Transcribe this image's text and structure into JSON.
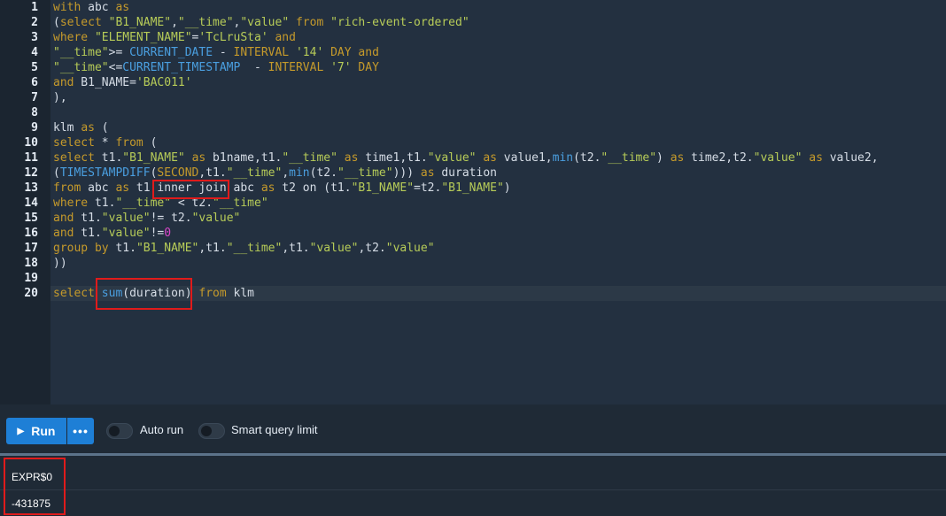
{
  "editor": {
    "lines": [
      {
        "num": "1",
        "tokens": [
          [
            "kw",
            "with"
          ],
          [
            "id",
            " abc "
          ],
          [
            "kw",
            "as"
          ]
        ]
      },
      {
        "num": "2",
        "tokens": [
          [
            "id",
            "("
          ],
          [
            "kw",
            "select"
          ],
          [
            "id",
            " "
          ],
          [
            "str",
            "\"B1_NAME\""
          ],
          [
            "id",
            ","
          ],
          [
            "str",
            "\"__time\""
          ],
          [
            "id",
            ","
          ],
          [
            "str",
            "\"value\""
          ],
          [
            "id",
            " "
          ],
          [
            "kw",
            "from"
          ],
          [
            "id",
            " "
          ],
          [
            "str",
            "\"rich-event-ordered\""
          ]
        ]
      },
      {
        "num": "3",
        "tokens": [
          [
            "kw",
            "where"
          ],
          [
            "id",
            " "
          ],
          [
            "str",
            "\"ELEMENT_NAME\""
          ],
          [
            "id",
            "="
          ],
          [
            "str",
            "'TcLruSta'"
          ],
          [
            "id",
            " "
          ],
          [
            "kw",
            "and"
          ]
        ]
      },
      {
        "num": "4",
        "tokens": [
          [
            "str",
            "\"__time\""
          ],
          [
            "id",
            ">= "
          ],
          [
            "fn",
            "CURRENT_DATE"
          ],
          [
            "id",
            " - "
          ],
          [
            "kw",
            "INTERVAL"
          ],
          [
            "id",
            " "
          ],
          [
            "str",
            "'14'"
          ],
          [
            "id",
            " "
          ],
          [
            "kw",
            "DAY"
          ],
          [
            "id",
            " "
          ],
          [
            "kw",
            "and"
          ]
        ]
      },
      {
        "num": "5",
        "tokens": [
          [
            "str",
            "\"__time\""
          ],
          [
            "id",
            "<="
          ],
          [
            "fn",
            "CURRENT_TIMESTAMP"
          ],
          [
            "id",
            "  - "
          ],
          [
            "kw",
            "INTERVAL"
          ],
          [
            "id",
            " "
          ],
          [
            "str",
            "'7'"
          ],
          [
            "id",
            " "
          ],
          [
            "kw",
            "DAY"
          ]
        ]
      },
      {
        "num": "6",
        "tokens": [
          [
            "kw",
            "and"
          ],
          [
            "id",
            " B1_NAME="
          ],
          [
            "str",
            "'BAC011'"
          ]
        ]
      },
      {
        "num": "7",
        "tokens": [
          [
            "id",
            "),"
          ]
        ]
      },
      {
        "num": "8",
        "tokens": []
      },
      {
        "num": "9",
        "tokens": [
          [
            "id",
            "klm "
          ],
          [
            "kw",
            "as"
          ],
          [
            "id",
            " ("
          ]
        ]
      },
      {
        "num": "10",
        "tokens": [
          [
            "kw",
            "select"
          ],
          [
            "id",
            " * "
          ],
          [
            "kw",
            "from"
          ],
          [
            "id",
            " ("
          ]
        ]
      },
      {
        "num": "11",
        "tokens": [
          [
            "kw",
            "select"
          ],
          [
            "id",
            " t1."
          ],
          [
            "str",
            "\"B1_NAME\""
          ],
          [
            "id",
            " "
          ],
          [
            "kw",
            "as"
          ],
          [
            "id",
            " b1name,t1."
          ],
          [
            "str",
            "\"__time\""
          ],
          [
            "id",
            " "
          ],
          [
            "kw",
            "as"
          ],
          [
            "id",
            " time1,t1."
          ],
          [
            "str",
            "\"value\""
          ],
          [
            "id",
            " "
          ],
          [
            "kw",
            "as"
          ],
          [
            "id",
            " value1,"
          ],
          [
            "fn",
            "min"
          ],
          [
            "id",
            "(t2."
          ],
          [
            "str",
            "\"__time\""
          ],
          [
            "id",
            ") "
          ],
          [
            "kw",
            "as"
          ],
          [
            "id",
            " time2,t2."
          ],
          [
            "str",
            "\"value\""
          ],
          [
            "id",
            " "
          ],
          [
            "kw",
            "as"
          ],
          [
            "id",
            " value2,"
          ]
        ]
      },
      {
        "num": "12",
        "tokens": [
          [
            "id",
            "("
          ],
          [
            "fn",
            "TIMESTAMPDIFF"
          ],
          [
            "id",
            "("
          ],
          [
            "kw",
            "SECOND"
          ],
          [
            "id",
            ",t1."
          ],
          [
            "str",
            "\"__time\""
          ],
          [
            "id",
            ","
          ],
          [
            "fn",
            "min"
          ],
          [
            "id",
            "(t2."
          ],
          [
            "str",
            "\"__time\""
          ],
          [
            "id",
            "))) "
          ],
          [
            "kw",
            "as"
          ],
          [
            "id",
            " duration"
          ]
        ]
      },
      {
        "num": "13",
        "tokens": [
          [
            "kw",
            "from"
          ],
          [
            "id",
            " abc "
          ],
          [
            "kw",
            "as"
          ],
          [
            "id",
            " t1 inner join abc "
          ],
          [
            "kw",
            "as"
          ],
          [
            "id",
            " t2 on (t1."
          ],
          [
            "str",
            "\"B1_NAME\""
          ],
          [
            "id",
            "=t2."
          ],
          [
            "str",
            "\"B1_NAME\""
          ],
          [
            "id",
            ")"
          ]
        ]
      },
      {
        "num": "14",
        "tokens": [
          [
            "kw",
            "where"
          ],
          [
            "id",
            " t1."
          ],
          [
            "str",
            "\"__time\""
          ],
          [
            "id",
            " < t2."
          ],
          [
            "str",
            "\"__time\""
          ]
        ]
      },
      {
        "num": "15",
        "tokens": [
          [
            "kw",
            "and"
          ],
          [
            "id",
            " t1."
          ],
          [
            "str",
            "\"value\""
          ],
          [
            "id",
            "!= t2."
          ],
          [
            "str",
            "\"value\""
          ]
        ]
      },
      {
        "num": "16",
        "tokens": [
          [
            "kw",
            "and"
          ],
          [
            "id",
            " t1."
          ],
          [
            "str",
            "\"value\""
          ],
          [
            "id",
            "!="
          ],
          [
            "num",
            "0"
          ]
        ]
      },
      {
        "num": "17",
        "tokens": [
          [
            "kw",
            "group by"
          ],
          [
            "id",
            " t1."
          ],
          [
            "str",
            "\"B1_NAME\""
          ],
          [
            "id",
            ",t1."
          ],
          [
            "str",
            "\"__time\""
          ],
          [
            "id",
            ",t1."
          ],
          [
            "str",
            "\"value\""
          ],
          [
            "id",
            ",t2."
          ],
          [
            "str",
            "\"value\""
          ]
        ]
      },
      {
        "num": "18",
        "tokens": [
          [
            "id",
            "))"
          ]
        ]
      },
      {
        "num": "19",
        "tokens": []
      },
      {
        "num": "20",
        "tokens": [
          [
            "kw",
            "select"
          ],
          [
            "id",
            " "
          ],
          [
            "fn",
            "sum"
          ],
          [
            "id",
            "(duration) "
          ],
          [
            "kw",
            "from"
          ],
          [
            "id",
            " klm"
          ]
        ]
      }
    ]
  },
  "toolbar": {
    "run_label": "Run",
    "more_label": "•••",
    "auto_run_label": "Auto run",
    "smart_limit_label": "Smart query limit"
  },
  "results": {
    "column": "EXPR$0",
    "value": "-431875"
  },
  "colors": {
    "keyword": "#c59a2b",
    "string": "#b7cc58",
    "function": "#4a9fe0",
    "number": "#d946c9",
    "highlight_box": "#e01b1b",
    "run_button": "#1e7fd6"
  }
}
